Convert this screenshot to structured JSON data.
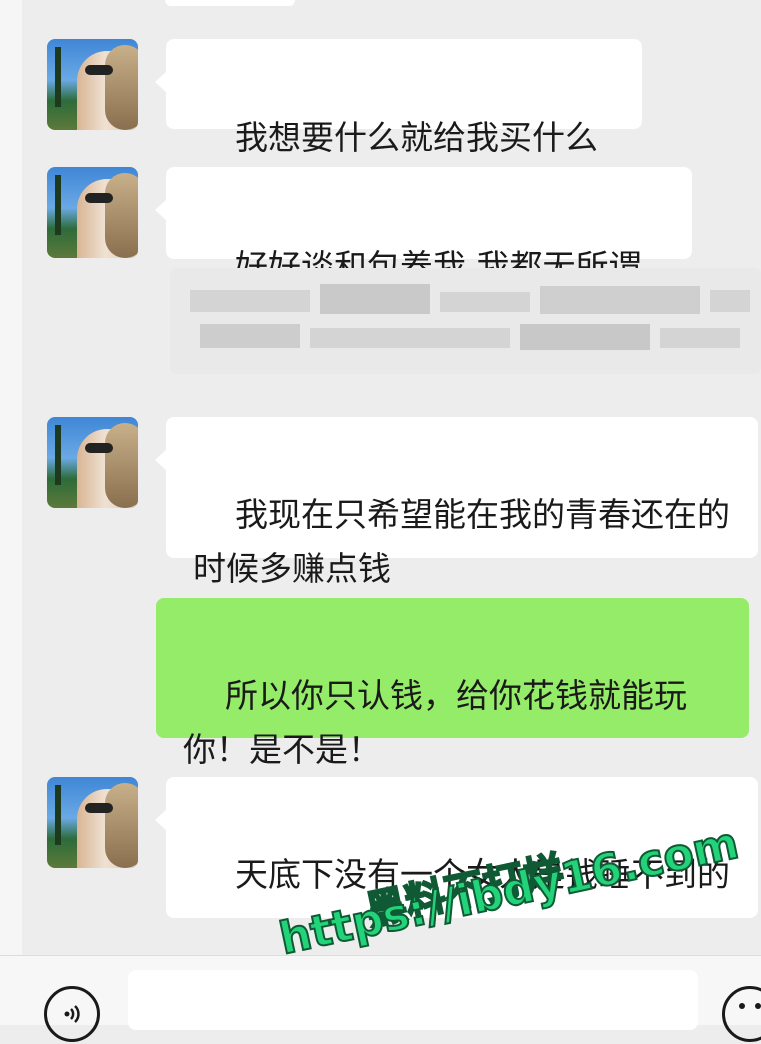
{
  "messages": [
    {
      "side": "left",
      "text": "我想要什么就给我买什么"
    },
    {
      "side": "left",
      "text": "好好谈和包养我 我都无所谓"
    },
    {
      "side": "left",
      "text": "我现在只希望能在我的青春还在的时候多赚点钱"
    },
    {
      "side": "right",
      "text": "所以你只认钱，给你花钱就能玩你！是不是！"
    },
    {
      "side": "left",
      "text": "天底下没有一个女人是钱睡不到的"
    }
  ],
  "watermark": {
    "line1": "黑料不打烊",
    "line2": "https://ibdy16.com"
  },
  "input_bar": {
    "voice_icon": "voice-icon",
    "emoji_icon": "emoji-icon",
    "input_value": ""
  },
  "colors": {
    "chat_background": "#ededed",
    "incoming_bubble": "#ffffff",
    "outgoing_bubble": "#95ec69",
    "watermark_fill": "#22d37a",
    "watermark_outline": "#0f5a34"
  }
}
